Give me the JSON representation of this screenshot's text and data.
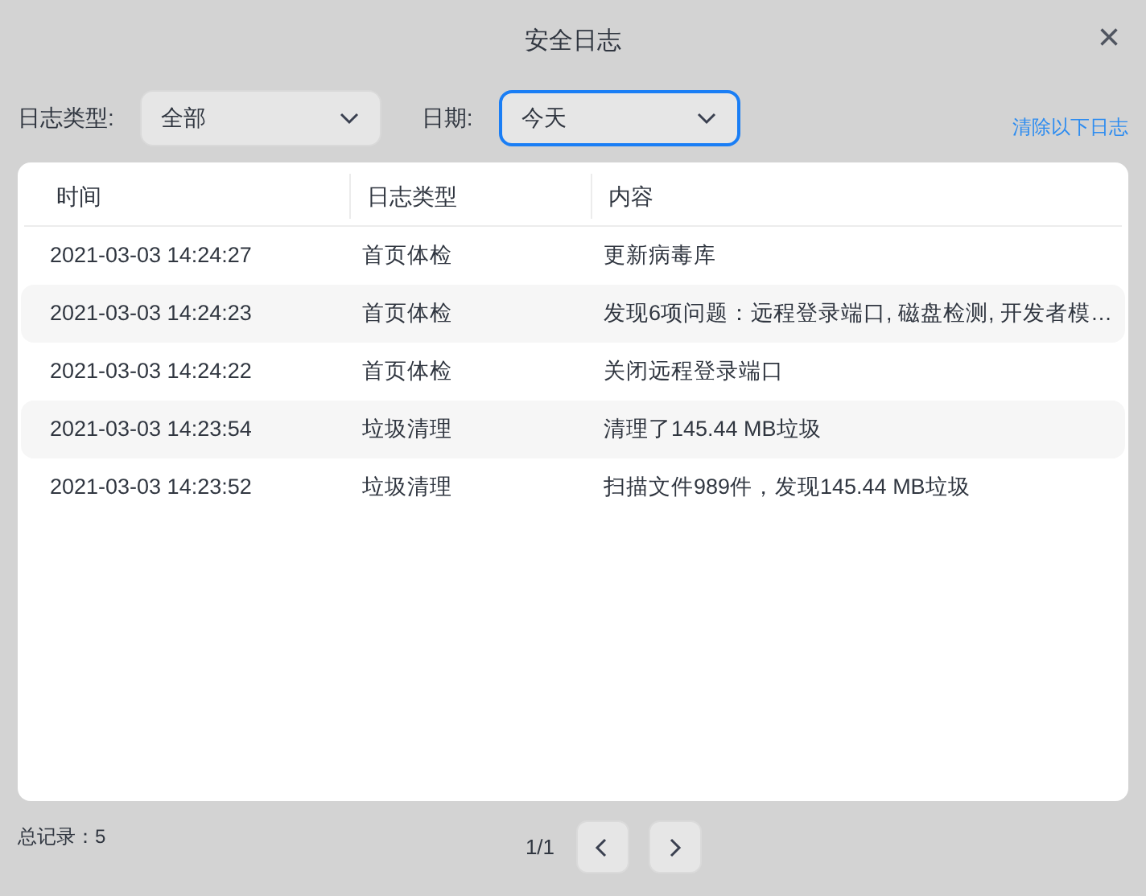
{
  "window": {
    "title": "安全日志",
    "close": "×"
  },
  "filters": [
    {
      "label": "日志类型:",
      "value": "全部",
      "focused": false
    },
    {
      "label": "日期:",
      "value": "今天",
      "focused": true
    }
  ],
  "clear_link": "清除以下日志",
  "table": {
    "columns": [
      "时间",
      "日志类型",
      "内容"
    ],
    "rows": [
      [
        "2021-03-03 14:24:27",
        "首页体检",
        "更新病毒库"
      ],
      [
        "2021-03-03 14:24:23",
        "首页体检",
        "发现6项问题：远程登录端口, 磁盘检测, 开发者模…"
      ],
      [
        "2021-03-03 14:24:22",
        "首页体检",
        "关闭远程登录端口"
      ],
      [
        "2021-03-03 14:23:54",
        "垃圾清理",
        "清理了145.44 MB垃圾"
      ],
      [
        "2021-03-03 14:23:52",
        "垃圾清理",
        "扫描文件989件，发现145.44 MB垃圾"
      ]
    ]
  },
  "footer": {
    "total": "总记录：5",
    "page": "1/1"
  }
}
